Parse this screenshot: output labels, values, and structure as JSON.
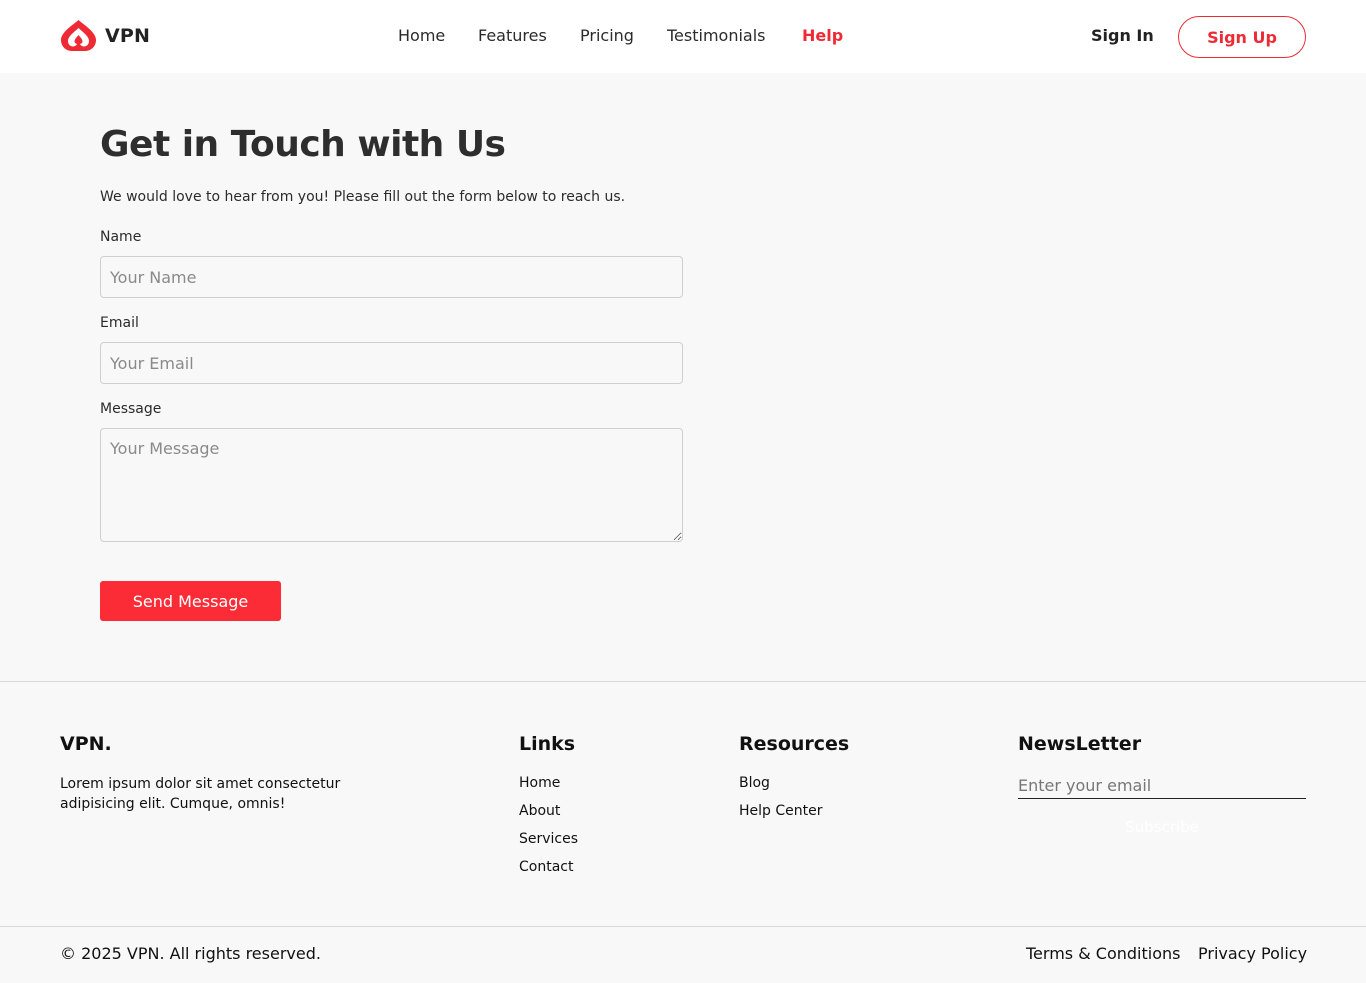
{
  "brand": {
    "name": "VPN",
    "accent_color": "#ee2b35",
    "logo_icon": "flame-drop-logo-icon"
  },
  "nav": {
    "items": [
      {
        "label": "Home",
        "active": false
      },
      {
        "label": "Features",
        "active": false
      },
      {
        "label": "Pricing",
        "active": false
      },
      {
        "label": "Testimonials",
        "active": false
      },
      {
        "label": "Help",
        "active": true
      }
    ],
    "signin_label": "Sign In",
    "signup_label": "Sign Up"
  },
  "contact": {
    "title": "Get in Touch with Us",
    "subtitle": "We would love to hear from you! Please fill out the form below to reach us.",
    "name_label": "Name",
    "name_placeholder": "Your Name",
    "email_label": "Email",
    "email_placeholder": "Your Email",
    "message_label": "Message",
    "message_placeholder": "Your Message",
    "send_label": "Send Message",
    "button_color": "#fb2c36"
  },
  "footer": {
    "brand": "VPN.",
    "description": "Lorem ipsum dolor sit amet consectetur adipisicing elit. Cumque, omnis!",
    "links_title": "Links",
    "links": [
      "Home",
      "About",
      "Services",
      "Contact"
    ],
    "resources_title": "Resources",
    "resources": [
      "Blog",
      "Help Center"
    ],
    "newsletter_title": "NewsLetter",
    "newsletter_placeholder": "Enter your email",
    "subscribe_label": "Subscribe",
    "copyright": "© 2025 VPN. All rights reserved.",
    "terms_label": "Terms & Conditions",
    "privacy_label": "Privacy Policy"
  }
}
